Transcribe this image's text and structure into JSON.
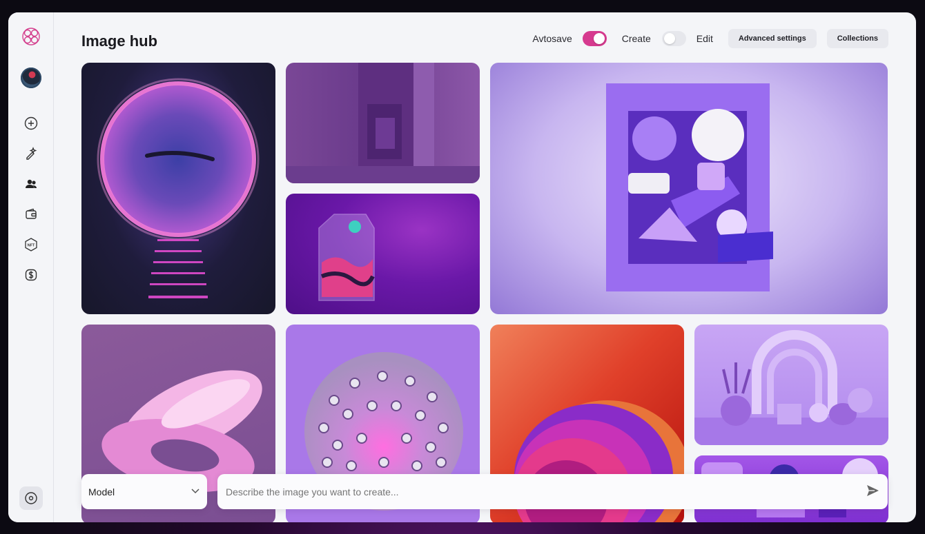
{
  "header": {
    "title": "Image hub"
  },
  "toolbar": {
    "autosave_label": "Avtosave",
    "autosave_on": true,
    "create_label": "Create",
    "mode_edit_on": false,
    "edit_label": "Edit",
    "advanced_label": "Advanced settings",
    "collections_label": "Collections"
  },
  "sidebar": {
    "items": [
      {
        "icon": "brain-logo-icon"
      },
      {
        "icon": "avatar"
      },
      {
        "icon": "plus-circle-icon"
      },
      {
        "icon": "sparkle-edit-icon"
      },
      {
        "icon": "users-icon"
      },
      {
        "icon": "wallet-icon"
      },
      {
        "icon": "nft-badge-icon",
        "label": "NFT"
      },
      {
        "icon": "dollar-icon"
      },
      {
        "icon": "settings-circle-icon"
      }
    ]
  },
  "gallery": {
    "images": [
      "neon-portal-stairs",
      "purple-corridor",
      "glass-milk-carton",
      "shapes-in-frame",
      "pink-twisted-ribbon",
      "spiky-sphere",
      "gradient-wave-shapes",
      "arch-vases-scene",
      "purple-abstract-objects"
    ]
  },
  "composer": {
    "model_label": "Model",
    "prompt_placeholder": "Describe the image you want to create..."
  },
  "colors": {
    "accent": "#d63a8f",
    "background": "#f4f5f8"
  }
}
